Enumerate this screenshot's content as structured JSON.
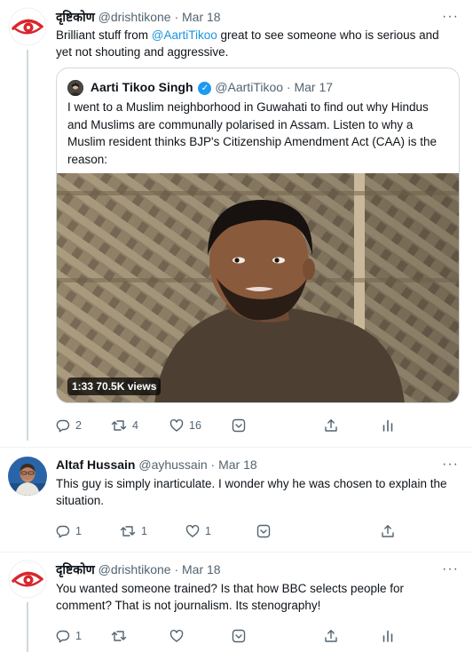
{
  "tweets": [
    {
      "name": "दृष्टिकोण",
      "handle": "@drishtikone",
      "dot": "·",
      "time": "Mar 18",
      "mention": "@AartiTikoo",
      "text_before": "Brilliant stuff from ",
      "text_after": " great to see someone who is serious and yet not shouting and aggressive.",
      "more": "···",
      "actions": {
        "reply": "2",
        "retweet": "4",
        "like": "16"
      }
    },
    {
      "name": "Altaf Hussain",
      "handle": "@ayhussain",
      "dot": "·",
      "time": "Mar 18",
      "text": "This guy is simply inarticulate. I wonder why he was chosen to explain the situation.",
      "more": "···",
      "actions": {
        "reply": "1",
        "retweet": "1",
        "like": "1"
      }
    },
    {
      "name": "दृष्टिकोण",
      "handle": "@drishtikone",
      "dot": "·",
      "time": "Mar 18",
      "text": "You wanted someone trained?  Is that how BBC selects people for comment?  That is not journalism.  Its stenography!",
      "more": "···",
      "actions": {
        "reply": "1",
        "retweet": "",
        "like": ""
      }
    }
  ],
  "quote": {
    "name": "Aarti Tikoo Singh",
    "handle": "@AartiTikoo",
    "dot": "·",
    "time": "Mar 17",
    "text": "I went to a Muslim neighborhood in Guwahati to find out why Hindus and Muslims are communally polarised in Assam. Listen to why a Muslim resident thinks BJP's Citizenship Amendment Act (CAA) is the reason:",
    "video": {
      "duration": "1:33",
      "views": "70.5K views"
    }
  },
  "colors": {
    "brand_red": "#d9262c",
    "link": "#1b95e0",
    "muted": "#536471",
    "border": "#cfd9de"
  },
  "icons": [
    "drishtikone-eye-logo",
    "more-icon",
    "verified-icon",
    "reply-icon",
    "retweet-icon",
    "like-icon",
    "hide-icon",
    "share-icon",
    "analytics-icon"
  ]
}
